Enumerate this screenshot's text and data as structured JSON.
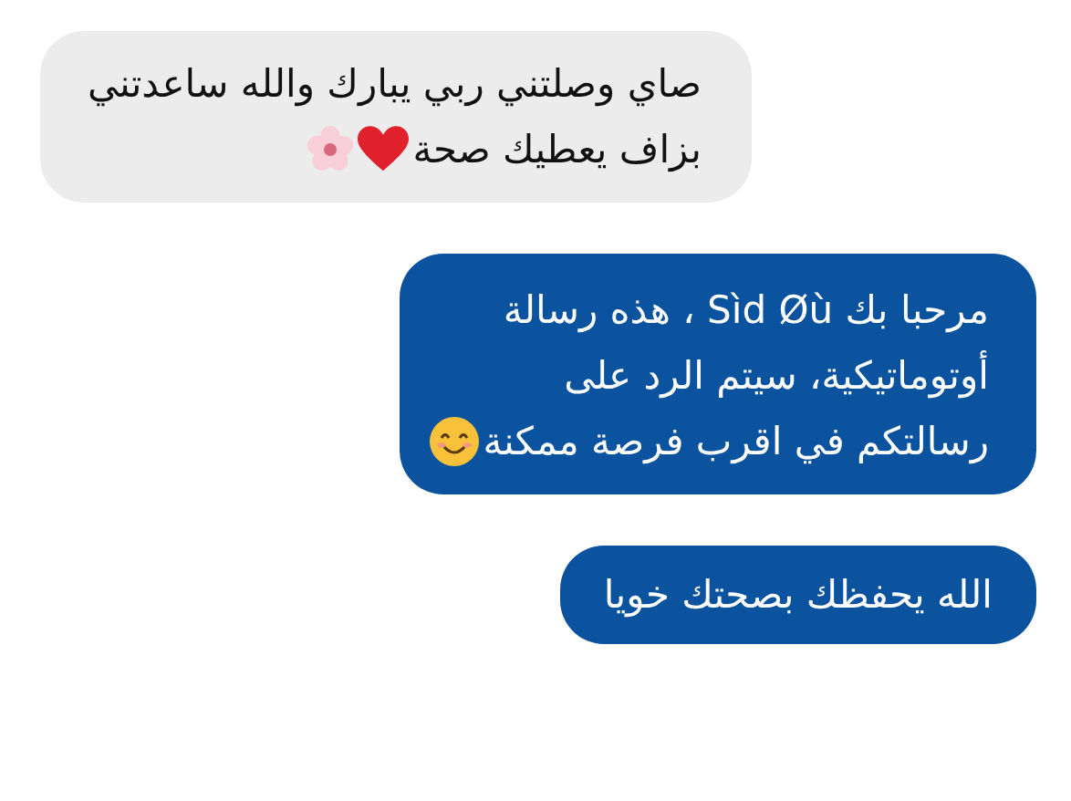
{
  "messages": [
    {
      "kind": "received",
      "lines": [
        "صاي وصلتني ربي يبارك والله ساعدتني",
        "بزاف يعطيك صحة"
      ]
    },
    {
      "kind": "sent",
      "lines": [
        "مرحبا بك Sìd Øù ، هذه رسالة",
        "أوتوماتيكية، سيتم الرد على",
        "رسالتكم في اقرب فرصة ممكنة"
      ]
    },
    {
      "kind": "sent",
      "lines": [
        "الله يحفظك بصحتك خويا"
      ]
    }
  ]
}
